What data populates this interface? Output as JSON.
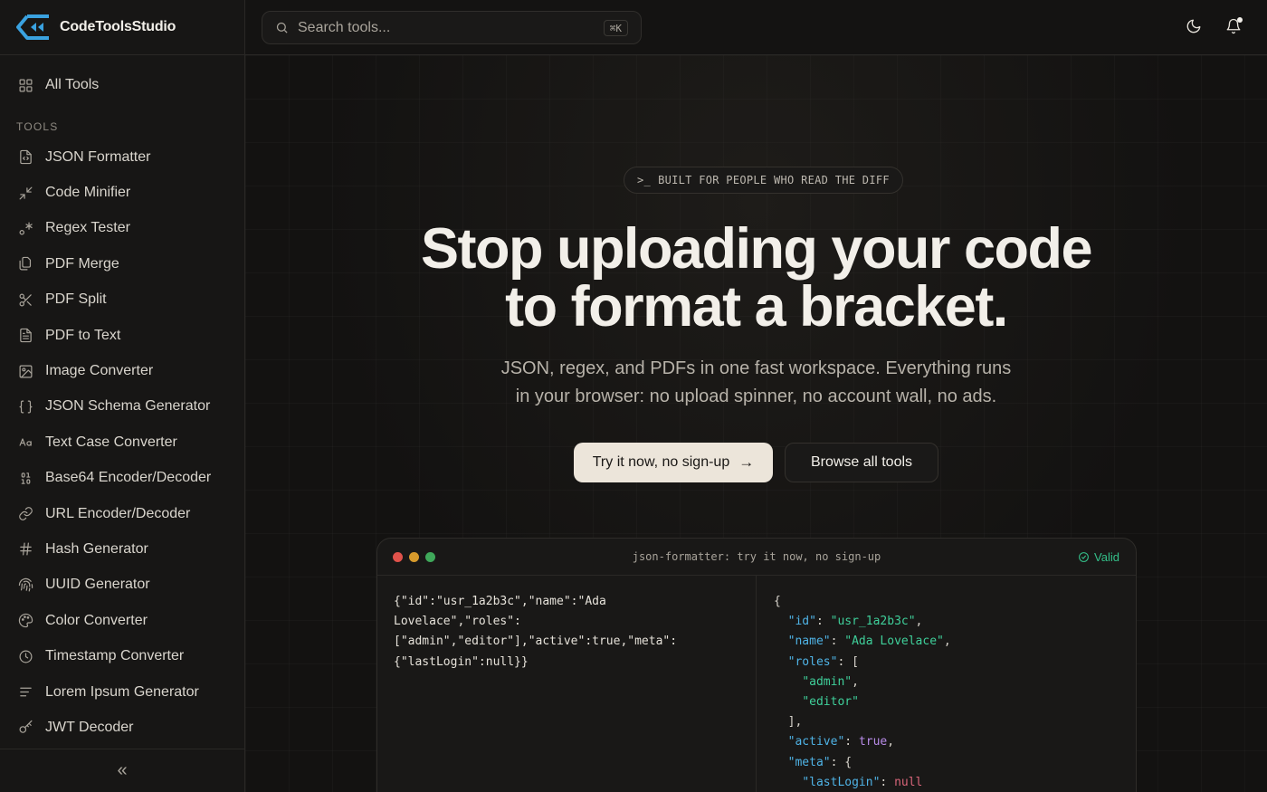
{
  "app": {
    "name": "CodeToolsStudio"
  },
  "sidebar": {
    "all_tools_label": "All Tools",
    "section_label": "TOOLS",
    "items": [
      {
        "label": "JSON Formatter",
        "icon": "file-code-icon"
      },
      {
        "label": "Code Minifier",
        "icon": "minimize-icon"
      },
      {
        "label": "Regex Tester",
        "icon": "regex-icon"
      },
      {
        "label": "PDF Merge",
        "icon": "files-icon"
      },
      {
        "label": "PDF Split",
        "icon": "scissors-icon"
      },
      {
        "label": "PDF to Text",
        "icon": "file-text-icon"
      },
      {
        "label": "Image Converter",
        "icon": "image-icon"
      },
      {
        "label": "JSON Schema Generator",
        "icon": "braces-icon"
      },
      {
        "label": "Text Case Converter",
        "icon": "case-icon"
      },
      {
        "label": "Base64 Encoder/Decoder",
        "icon": "binary-icon"
      },
      {
        "label": "URL Encoder/Decoder",
        "icon": "link-icon"
      },
      {
        "label": "Hash Generator",
        "icon": "hash-icon"
      },
      {
        "label": "UUID Generator",
        "icon": "fingerprint-icon"
      },
      {
        "label": "Color Converter",
        "icon": "palette-icon"
      },
      {
        "label": "Timestamp Converter",
        "icon": "clock-icon"
      },
      {
        "label": "Lorem Ipsum Generator",
        "icon": "text-lines-icon"
      },
      {
        "label": "JWT Decoder",
        "icon": "key-icon"
      }
    ],
    "collapse_glyph": "«"
  },
  "header": {
    "search_placeholder": "Search tools...",
    "search_shortcut": "⌘K"
  },
  "hero": {
    "badge_prompt": ">_",
    "badge_text": "BUILT FOR PEOPLE WHO READ THE DIFF",
    "title_line1": "Stop uploading your code",
    "title_line2": "to format a bracket.",
    "subtitle_line1": "JSON, regex, and PDFs in one fast workspace. Everything runs",
    "subtitle_line2": "in your browser: no upload spinner, no account wall, no ads.",
    "primary_cta": "Try it now, no sign-up",
    "primary_cta_arrow": "→",
    "secondary_cta": "Browse all tools"
  },
  "demo": {
    "title": "json-formatter: try it now, no sign-up",
    "status": "Valid",
    "input_lines": [
      "{\"id\":\"usr_1a2b3c\",\"name\":\"Ada",
      "Lovelace\",\"roles\":",
      "[\"admin\",\"editor\"],\"active\":true,\"meta\":",
      "{\"lastLogin\":null}}"
    ],
    "output": {
      "open": "{",
      "id_key": "\"id\"",
      "id_val": "\"usr_1a2b3c\"",
      "name_key": "\"name\"",
      "name_val": "\"Ada Lovelace\"",
      "roles_key": "\"roles\"",
      "roles_open": "[",
      "role1": "\"admin\"",
      "role2": "\"editor\"",
      "roles_close": "],",
      "active_key": "\"active\"",
      "active_val": "true",
      "meta_key": "\"meta\"",
      "meta_open": "{",
      "last_key": "\"lastLogin\"",
      "last_val": "null"
    },
    "colors": {
      "red": "#e0524b",
      "yellow": "#d69a2c",
      "green": "#3fa85a",
      "valid": "#34c08a"
    }
  }
}
